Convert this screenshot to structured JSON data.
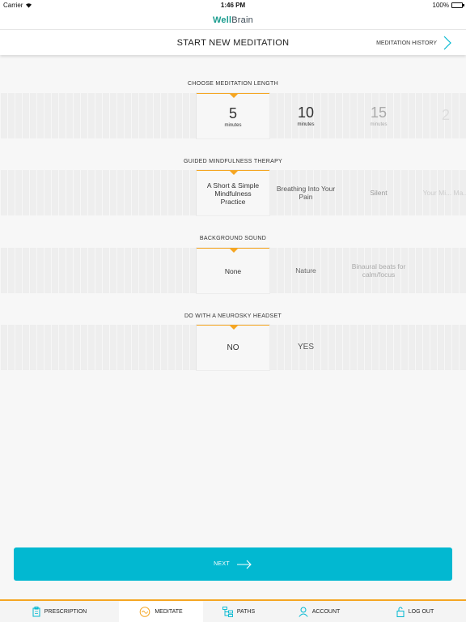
{
  "status_bar": {
    "carrier": "Carrier",
    "time": "1:46 PM",
    "battery": "100%"
  },
  "header": {
    "logo_bold": "Well",
    "logo_light": "Brain"
  },
  "nav": {
    "title": "START NEW MEDITATION",
    "history_label": "MEDITATION HISTORY"
  },
  "sections": {
    "length": {
      "label": "CHOOSE MEDITATION LENGTH",
      "options": [
        {
          "value": "5",
          "unit": "minutes"
        },
        {
          "value": "10",
          "unit": "minutes"
        },
        {
          "value": "15",
          "unit": "minutes"
        },
        {
          "value": "2",
          "unit": ""
        }
      ]
    },
    "guided": {
      "label": "GUIDED MINDFULNESS THERAPY",
      "options": [
        "A Short & Simple Mindfulness Practice",
        "Breathing Into Your Pain",
        "Silent",
        "Your Mi... Ma..."
      ]
    },
    "sound": {
      "label": "BACKGROUND SOUND",
      "options": [
        "None",
        "Nature",
        "Binaural beats for calm/focus"
      ]
    },
    "headset": {
      "label": "DO WITH A NEUROSKY HEADSET",
      "options": [
        "NO",
        "YES"
      ]
    }
  },
  "next_button": {
    "label": "NEXT"
  },
  "tabs": [
    {
      "label": "PRESCRIPTION",
      "icon": "prescription-icon"
    },
    {
      "label": "MEDITATE",
      "icon": "meditate-icon"
    },
    {
      "label": "PATHS",
      "icon": "paths-icon"
    },
    {
      "label": "ACCOUNT",
      "icon": "account-icon"
    },
    {
      "label": "LOG OUT",
      "icon": "logout-icon"
    }
  ],
  "colors": {
    "accent": "#f5a623",
    "primary": "#02b8d1",
    "brand": "#1a9c8e"
  }
}
